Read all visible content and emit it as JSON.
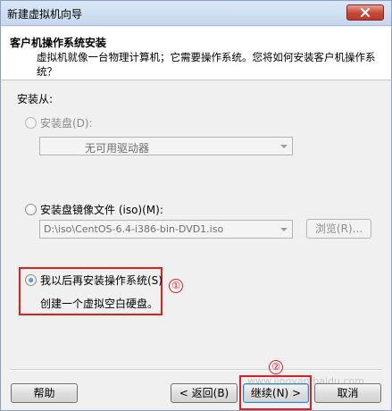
{
  "window": {
    "title": "新建虚拟机向导"
  },
  "header": {
    "title": "客户机操作系统安装",
    "description": "虚拟机就像一台物理计算机；它需要操作系统。您将如何安装客户机操作系统？"
  },
  "install_from_label": "安装从:",
  "options": {
    "disc": {
      "label": "安装盘(D):",
      "selected": false,
      "enabled": false,
      "combo_value": "无可用驱动器"
    },
    "iso": {
      "label": "安装盘镜像文件 (iso)(M):",
      "selected": false,
      "enabled": true,
      "path_value": "D:\\iso\\CentOS-6.4-i386-bin-DVD1.iso",
      "browse_label": "浏览(R)..."
    },
    "later": {
      "label": "我以后再安装操作系统(S)",
      "selected": true,
      "enabled": true,
      "note": "创建一个虚拟空白硬盘。"
    }
  },
  "annotations": {
    "marker1": "①",
    "marker2": "②"
  },
  "footer": {
    "help_label": "帮助",
    "back_label": "< 返回(B)",
    "next_label": "继续(N) >",
    "cancel_label": "取消",
    "watermark": "www.jingyan.baidu.com"
  },
  "colors": {
    "annotation_red": "#e02020",
    "titlebar": "#c6d7ee",
    "close_red": "#c74632"
  }
}
